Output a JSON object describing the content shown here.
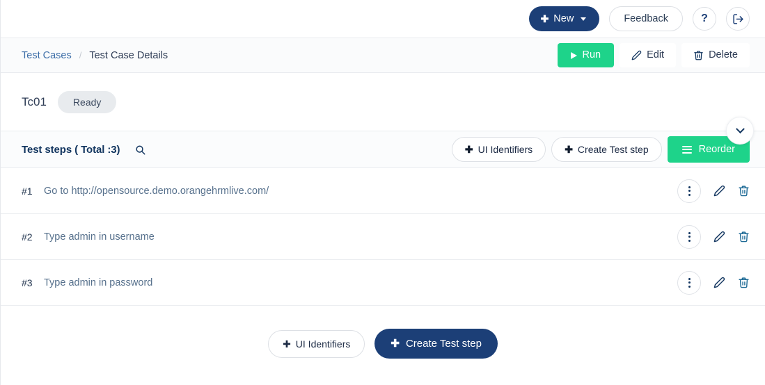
{
  "topbar": {
    "new_label": "New",
    "new_icon": "plus-icon",
    "new_caret_icon": "caret-down-icon",
    "feedback_label": "Feedback",
    "help_label": "?",
    "help_icon": "question-mark-icon",
    "logout_icon": "logout-icon"
  },
  "breadcrumb": {
    "parent": "Test Cases",
    "separator": "/",
    "current": "Test Case Details"
  },
  "crumb_actions": {
    "run_label": "Run",
    "run_icon": "play-icon",
    "edit_label": "Edit",
    "edit_icon": "pencil-icon",
    "delete_label": "Delete",
    "delete_icon": "trash-icon"
  },
  "testcase": {
    "name": "Tc01",
    "status": "Ready",
    "collapse_icon": "chevron-down-icon"
  },
  "steps_header": {
    "title": "Test steps ( Total :3)",
    "search_icon": "search-icon",
    "ui_identifiers_label": "UI Identifiers",
    "create_step_label": "Create Test step",
    "reorder_label": "Reorder",
    "reorder_icon": "hamburger-icon",
    "plus_icon": "plus-icon"
  },
  "steps": [
    {
      "num": "#1",
      "text": "Go to http://opensource.demo.orangehrmlive.com/",
      "menu_icon": "more-vertical-icon",
      "edit_icon": "pencil-icon",
      "delete_icon": "trash-icon"
    },
    {
      "num": "#2",
      "text": "Type admin in username",
      "menu_icon": "more-vertical-icon",
      "edit_icon": "pencil-icon",
      "delete_icon": "trash-icon"
    },
    {
      "num": "#3",
      "text": "Type admin in password",
      "menu_icon": "more-vertical-icon",
      "edit_icon": "pencil-icon",
      "delete_icon": "trash-icon"
    }
  ],
  "footer": {
    "ui_identifiers_label": "UI Identifiers",
    "create_step_label": "Create Test step",
    "plus_icon": "plus-icon"
  },
  "colors": {
    "navy": "#1c3f77",
    "green": "#1ed38a",
    "link_blue": "#3d6ea8",
    "step_text": "#56708c",
    "pill_gray": "#e8ebee"
  }
}
